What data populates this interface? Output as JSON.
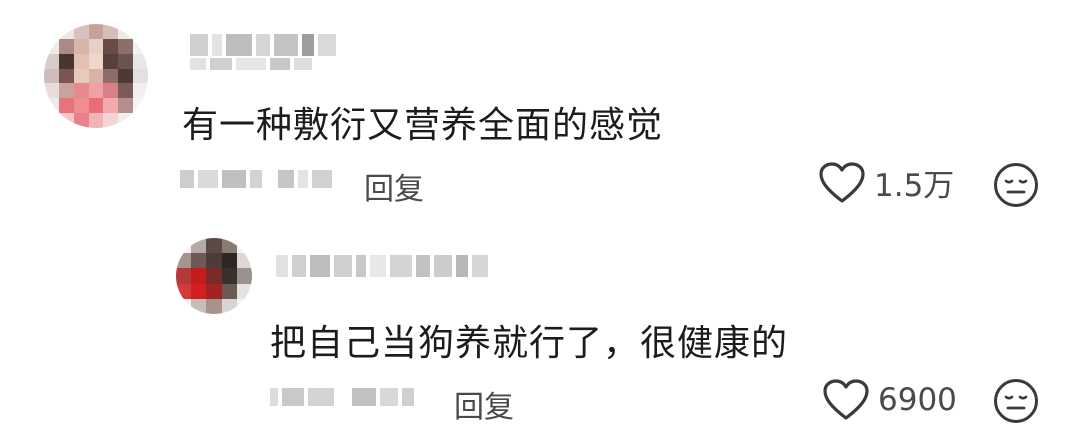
{
  "comments": [
    {
      "text": "有一种敷衍又营养全面的感觉",
      "reply_label": "回复",
      "likes": "1.5万",
      "icons": {
        "like": "heart-outline-icon",
        "dislike": "meh-face-icon"
      },
      "username_obscured": true,
      "meta_obscured": true
    },
    {
      "text": "把自己当狗养就行了，很健康的",
      "reply_label": "回复",
      "likes": "6900",
      "icons": {
        "like": "heart-outline-icon",
        "dislike": "meh-face-icon"
      },
      "username_obscured": true,
      "meta_obscured": true,
      "is_reply": true
    }
  ],
  "colors": {
    "text_primary": "#1c1c1c",
    "text_secondary": "#4a4a4a",
    "mosaic_gray": "#c9c9c9"
  }
}
